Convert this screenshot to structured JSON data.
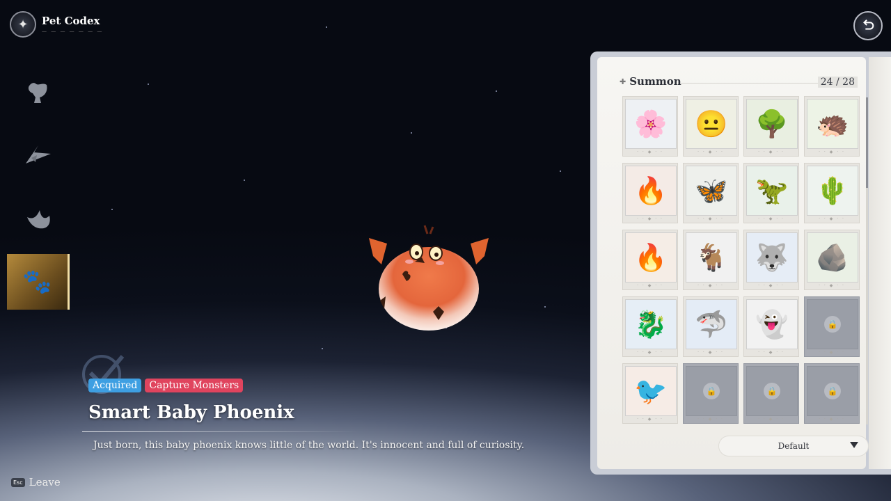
{
  "header": {
    "title": "Pet Codex",
    "subtitle": "— — — — — — —"
  },
  "nav": {
    "items": [
      {
        "name": "pet-vessel",
        "icon": "vessel-icon",
        "active": false
      },
      {
        "name": "glider",
        "icon": "glider-icon",
        "active": false
      },
      {
        "name": "wings",
        "icon": "wings-icon",
        "active": false
      },
      {
        "name": "pets",
        "icon": "paw-icon",
        "active": true
      }
    ]
  },
  "pet": {
    "tags": {
      "acquired": "Acquired",
      "source": "Capture Monsters"
    },
    "name": "Smart Baby Phoenix",
    "description": "Just born, this baby phoenix knows little of the world. It's innocent and full of curiosity."
  },
  "footer": {
    "esc_key": "Esc",
    "leave_label": "Leave"
  },
  "codex": {
    "section_title": "Summon",
    "count": "24 / 28",
    "sort_label": "Default",
    "cards": [
      {
        "id": "violet-flower",
        "locked": false,
        "bg": "#eef1f4",
        "emoji": "🌸"
      },
      {
        "id": "pale-blob",
        "locked": false,
        "bg": "#eff0e4",
        "emoji": "😐"
      },
      {
        "id": "tree-golem",
        "locked": false,
        "bg": "#e9efe1",
        "emoji": "🌳"
      },
      {
        "id": "leaf-hedgehog",
        "locked": false,
        "bg": "#edf3e6",
        "emoji": "🦔"
      },
      {
        "id": "fire-wisp",
        "locked": false,
        "bg": "#f4ebe6",
        "emoji": "🔥"
      },
      {
        "id": "bone-moth",
        "locked": false,
        "bg": "#eef0ec",
        "emoji": "🦋"
      },
      {
        "id": "green-dino",
        "locked": false,
        "bg": "#e9f1ea",
        "emoji": "🦖"
      },
      {
        "id": "cactus-bow",
        "locked": false,
        "bg": "#eef3ef",
        "emoji": "🌵"
      },
      {
        "id": "flame-sprite",
        "locked": false,
        "bg": "#f5ede6",
        "emoji": "🔥"
      },
      {
        "id": "white-goat",
        "locked": false,
        "bg": "#f1f1f1",
        "emoji": "🐐"
      },
      {
        "id": "ice-wolf",
        "locked": false,
        "bg": "#e6edf6",
        "emoji": "🐺"
      },
      {
        "id": "rock-golem",
        "locked": false,
        "bg": "#eaf0e5",
        "emoji": "🪨"
      },
      {
        "id": "blue-dragon",
        "locked": false,
        "bg": "#e6eef6",
        "emoji": "🐉"
      },
      {
        "id": "blue-shark",
        "locked": false,
        "bg": "#e4ecf6",
        "emoji": "🦈"
      },
      {
        "id": "ghost",
        "locked": false,
        "bg": "#f2f2f2",
        "emoji": "👻"
      },
      {
        "id": "locked-1",
        "locked": true
      },
      {
        "id": "baby-phoenix",
        "locked": false,
        "bg": "#f6ece6",
        "emoji": "🐦"
      },
      {
        "id": "locked-2",
        "locked": true
      },
      {
        "id": "locked-3",
        "locked": true
      },
      {
        "id": "locked-4",
        "locked": true
      }
    ]
  }
}
